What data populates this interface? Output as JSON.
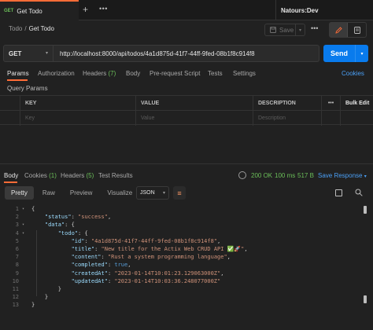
{
  "tab": {
    "method": "GET",
    "title": "Get Todo",
    "plus": "+",
    "more": "•••"
  },
  "environment": {
    "name": "Natours:Dev"
  },
  "breadcrumb": {
    "parent": "Todo",
    "separator": "/",
    "current": "Get Todo"
  },
  "toolbar": {
    "save_label": "Save",
    "more": "•••"
  },
  "request": {
    "method": "GET",
    "url": "http://localhost:8000/api/todos/4a1d875d-41f7-44ff-9fed-08b1f8c914f8",
    "send_label": "Send",
    "tabs": [
      {
        "label": "Params",
        "count": ""
      },
      {
        "label": "Authorization",
        "count": ""
      },
      {
        "label": "Headers",
        "count": "(7)"
      },
      {
        "label": "Body",
        "count": ""
      },
      {
        "label": "Pre-request Script",
        "count": ""
      },
      {
        "label": "Tests",
        "count": ""
      },
      {
        "label": "Settings",
        "count": ""
      }
    ],
    "cookies_label": "Cookies",
    "query_params_title": "Query Params",
    "params_table": {
      "headers": [
        "KEY",
        "VALUE",
        "DESCRIPTION",
        "•••",
        "Bulk Edit"
      ],
      "placeholders": [
        "Key",
        "Value",
        "Description"
      ]
    }
  },
  "response": {
    "tabs": [
      {
        "label": "Body",
        "count": ""
      },
      {
        "label": "Cookies",
        "count": "(1)"
      },
      {
        "label": "Headers",
        "count": "(5)"
      },
      {
        "label": "Test Results",
        "count": ""
      }
    ],
    "status": "200 OK",
    "time": "100 ms",
    "size": "517 B",
    "save_label": "Save Response",
    "views": [
      "Pretty",
      "Raw",
      "Preview",
      "Visualize"
    ],
    "format": "JSON",
    "lines": [
      "{",
      "    \"status\": \"success\",",
      "    \"data\": {",
      "        \"todo\": {",
      "            \"id\": \"4a1d875d-41f7-44ff-9fed-08b1f8c914f8\",",
      "            \"title\": \"New title for the Actix Web CRUD API ✅🚀\",",
      "            \"content\": \"Rust a system programming language\",",
      "            \"completed\": true,",
      "            \"createdAt\": \"2023-01-14T10:01:23.129063000Z\",",
      "            \"updatedAt\": \"2023-01-14T10:03:36.248077000Z\"",
      "        }",
      "    }",
      "}"
    ]
  }
}
